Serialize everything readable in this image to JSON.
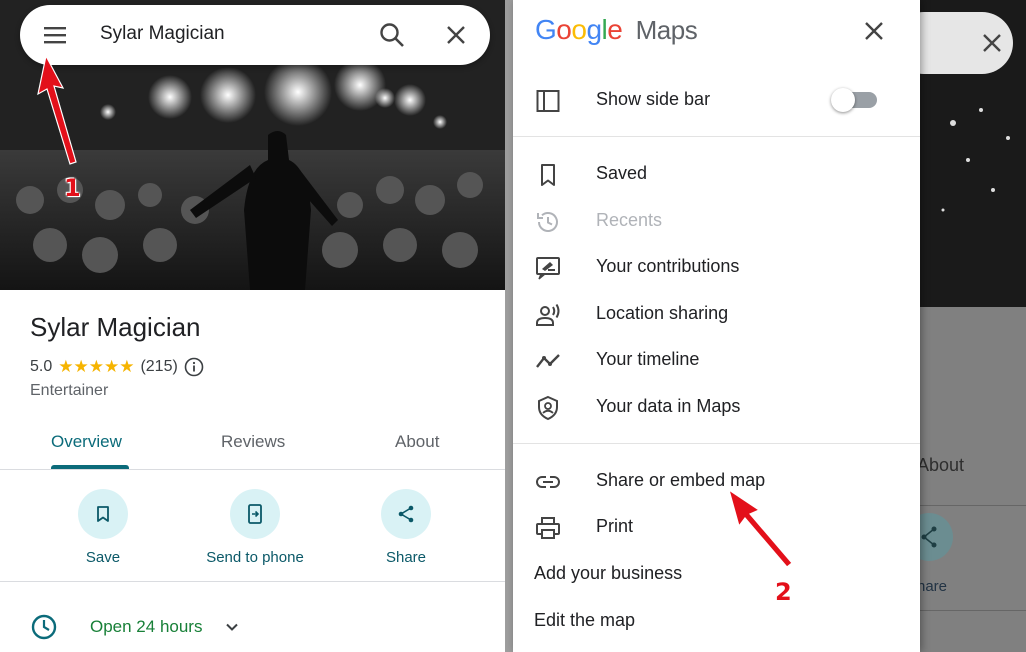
{
  "search": {
    "query": "Sylar Magician"
  },
  "place": {
    "name": "Sylar Magician",
    "rating": "5.0",
    "stars": "★★★★★",
    "review_count": "(215)",
    "category": "Entertainer"
  },
  "tabs": [
    {
      "label": "Overview",
      "active": true
    },
    {
      "label": "Reviews",
      "active": false
    },
    {
      "label": "About",
      "active": false
    }
  ],
  "actions": [
    {
      "label": "Save",
      "icon": "bookmark-icon"
    },
    {
      "label": "Send to phone",
      "icon": "send-to-phone-icon"
    },
    {
      "label": "Share",
      "icon": "share-icon"
    }
  ],
  "hours": {
    "label": "Open 24 hours"
  },
  "annotations": {
    "one": "1",
    "two": "2"
  },
  "drawer": {
    "logo_google": "Google",
    "logo_maps": "Maps",
    "sidebar_toggle": {
      "label": "Show side bar",
      "on": false
    },
    "items_group1": [
      {
        "label": "Saved",
        "icon": "bookmark-icon"
      },
      {
        "label": "Recents",
        "icon": "history-icon",
        "disabled": true
      },
      {
        "label": "Your contributions",
        "icon": "contributions-icon"
      },
      {
        "label": "Location sharing",
        "icon": "location-sharing-icon"
      },
      {
        "label": "Your timeline",
        "icon": "timeline-icon"
      },
      {
        "label": "Your data in Maps",
        "icon": "shield-icon"
      }
    ],
    "items_group2": [
      {
        "label": "Share or embed map",
        "icon": "link-icon"
      },
      {
        "label": "Print",
        "icon": "print-icon"
      },
      {
        "label": "Add your business"
      },
      {
        "label": "Edit the map"
      }
    ]
  },
  "background_right": {
    "about_label": "About",
    "share_label": "hare"
  },
  "colors": {
    "accent_teal": "#0b6b7a",
    "star_yellow": "#f6b400",
    "open_green": "#188038",
    "annotation_red": "#e3101a"
  }
}
